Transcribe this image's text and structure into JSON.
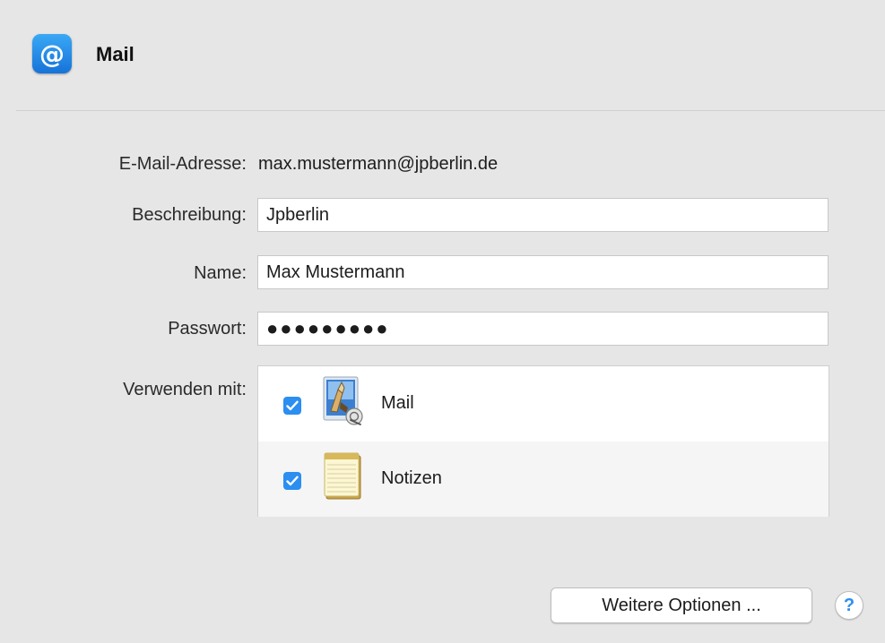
{
  "header": {
    "icon_glyph": "@",
    "icon": "at-sign-icon",
    "title": "Mail"
  },
  "form": {
    "email_label": "E-Mail-Adresse:",
    "email_value": "max.mustermann@jpberlin.de",
    "description_label": "Beschreibung:",
    "description_value": "Jpberlin",
    "name_label": "Name:",
    "name_value": "Max Mustermann",
    "password_label": "Passwort:",
    "password_value": "●●●●●●●●●",
    "use_with_label": "Verwenden mit:"
  },
  "use_with": [
    {
      "label": "Mail",
      "checked": true,
      "icon": "mail-app-icon"
    },
    {
      "label": "Notizen",
      "checked": true,
      "icon": "notes-app-icon"
    }
  ],
  "footer": {
    "more_options_label": "Weitere Optionen ...",
    "help_glyph": "?"
  },
  "colors": {
    "background": "#e6e6e6",
    "accent": "#2b8ef0",
    "icon_gradient_top": "#3aa8f5",
    "icon_gradient_bottom": "#1673d9"
  }
}
